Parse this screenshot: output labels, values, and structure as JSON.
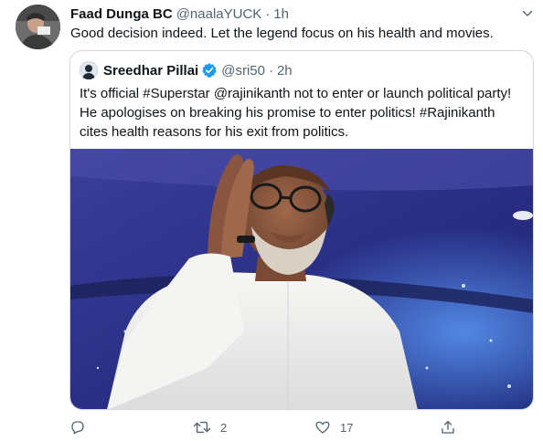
{
  "tweet": {
    "display_name": "Faad Dunga BC",
    "handle": "@naalaYUCK",
    "separator": "·",
    "time": "1h",
    "text": "Good decision indeed. Let the legend focus on his health and movies."
  },
  "quoted_tweet": {
    "display_name": "Sreedhar Pillai",
    "handle": "@sri50",
    "separator": "·",
    "time": "2h",
    "text_lines": [
      "It's official #Superstar @rajinikanth not to enter or launch political party!",
      "He apologises on breaking his promise to enter politics! #Rajinikanth",
      "cites health reasons for his exit from politics."
    ],
    "verified": true
  },
  "actions": {
    "retweet_count": "2",
    "like_count": "17"
  },
  "colors": {
    "text_primary": "#0f1419",
    "text_secondary": "#536471",
    "verified_blue": "#1d9bf0",
    "border": "#cfd9de"
  },
  "icons": [
    "caret-down-icon",
    "verified-badge-icon",
    "reply-icon",
    "retweet-icon",
    "like-icon",
    "share-icon"
  ]
}
